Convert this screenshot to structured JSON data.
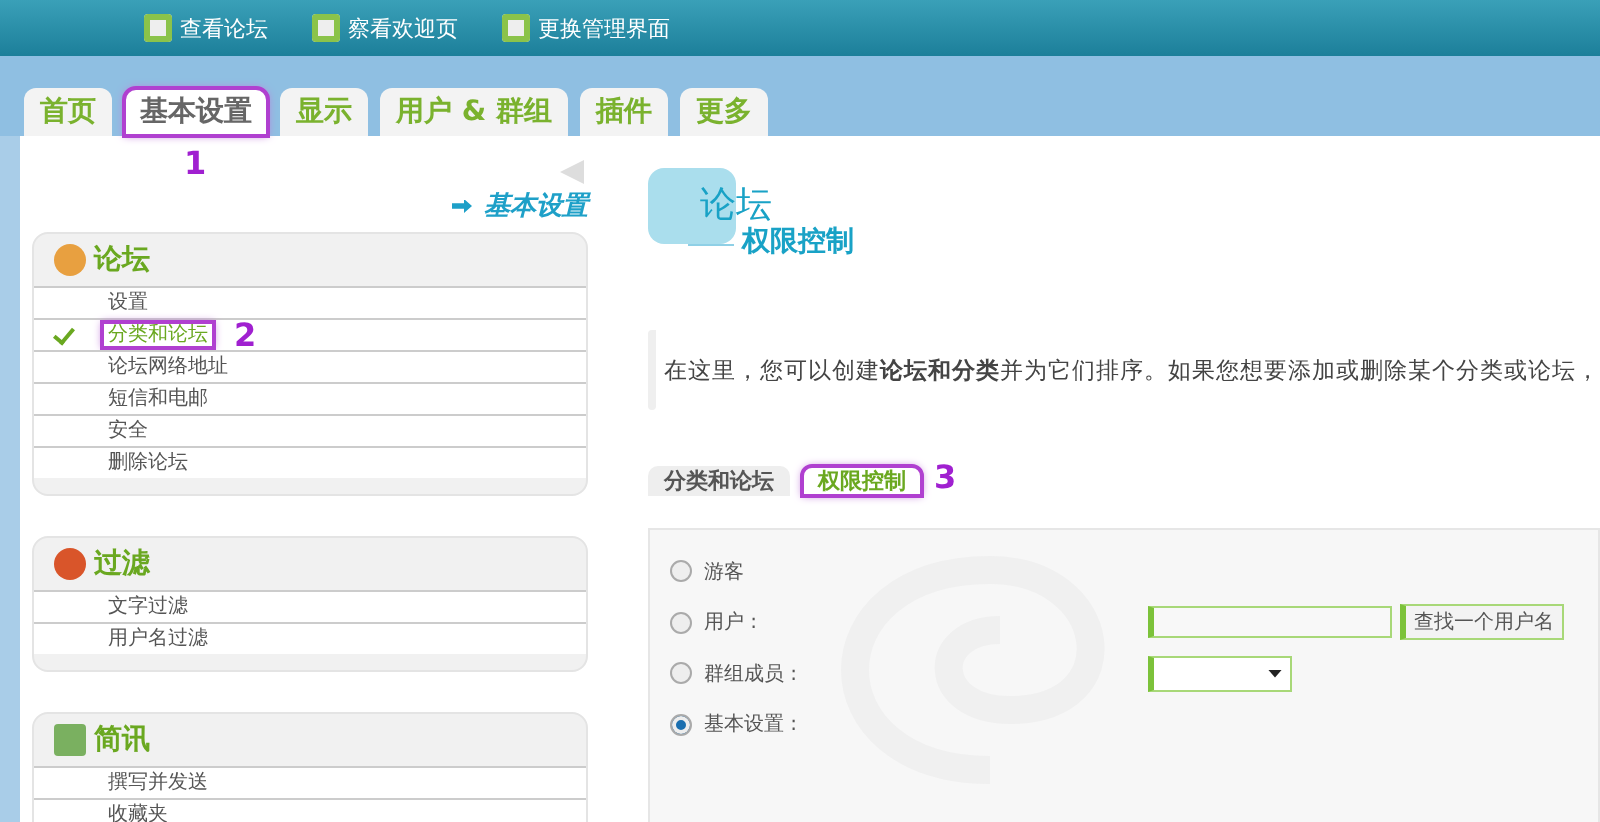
{
  "toolbar": {
    "links": [
      {
        "label": "查看论坛"
      },
      {
        "label": "察看欢迎页"
      },
      {
        "label": "更换管理界面"
      }
    ]
  },
  "tabs": [
    {
      "label": "首页",
      "selected": false
    },
    {
      "label": "基本设置",
      "selected": true,
      "annotation": "1"
    },
    {
      "label": "显示",
      "selected": false
    },
    {
      "label": "用户 & 群组",
      "selected": false
    },
    {
      "label": "插件",
      "selected": false
    },
    {
      "label": "更多",
      "selected": false
    }
  ],
  "sidebar": {
    "heading": "基本设置",
    "sections": [
      {
        "title": "论坛",
        "kind": "forum",
        "items": [
          {
            "label": "设置",
            "selected": false
          },
          {
            "label": "分类和论坛",
            "selected": true,
            "annotation": "2"
          },
          {
            "label": "论坛网络地址",
            "selected": false
          },
          {
            "label": "短信和电邮",
            "selected": false
          },
          {
            "label": "安全",
            "selected": false
          },
          {
            "label": "删除论坛",
            "selected": false
          }
        ]
      },
      {
        "title": "过滤",
        "kind": "filter",
        "items": [
          {
            "label": "文字过滤",
            "selected": false
          },
          {
            "label": "用户名过滤",
            "selected": false
          }
        ]
      },
      {
        "title": "简讯",
        "kind": "mail",
        "items": [
          {
            "label": "撰写并发送",
            "selected": false
          },
          {
            "label": "收藏夹",
            "selected": false
          }
        ]
      }
    ]
  },
  "main": {
    "title": "论坛",
    "subtitle": "权限控制",
    "intro": "在这里，您可以创建**论坛和分类**并为它们排序。如果您想要添加或删除某个分类或论坛，",
    "subtabs": [
      {
        "label": "分类和论坛",
        "selected": false
      },
      {
        "label": "权限控制",
        "selected": true,
        "annotation": "3"
      }
    ],
    "options": [
      {
        "label": "游客",
        "selected": false,
        "kind": "plain"
      },
      {
        "label": "用户 :",
        "selected": false,
        "kind": "user"
      },
      {
        "label": "群组成员 :",
        "selected": false,
        "kind": "group"
      },
      {
        "label": "基本设置 :",
        "selected": true,
        "kind": "plain"
      }
    ],
    "find_button": "查找一个用户名"
  }
}
